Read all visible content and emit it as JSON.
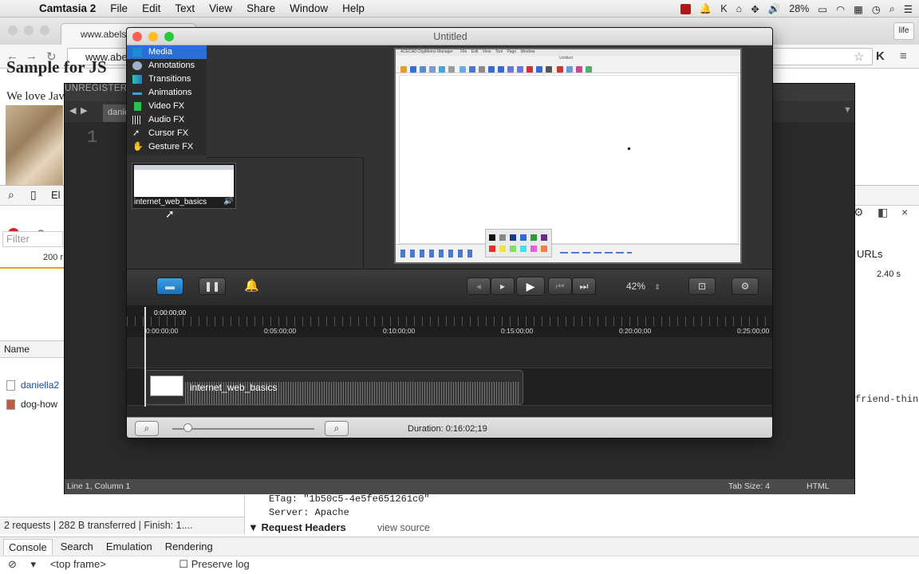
{
  "menubar": {
    "app": "Camtasia 2",
    "items": [
      "File",
      "Edit",
      "Text",
      "View",
      "Share",
      "Window",
      "Help"
    ],
    "battery": "28%"
  },
  "chrome": {
    "tab_title": "www.abelski...",
    "url": "www.abe",
    "life_button": "life",
    "page_title": "Sample for JS",
    "page_text": "We love Jav"
  },
  "devtools": {
    "filter_placeholder": "Filter",
    "timeline_tick": "200 r",
    "name_header": "Name",
    "rows": [
      "daniella2",
      "dog-how"
    ],
    "right_header": "URLs",
    "right_time": "2.40 s",
    "right_code": "friend-thin",
    "etag_line": "ETag: \"1b50c5-4e5fe651261c0\"",
    "server_line": "Server: Apache",
    "request_headers": "Request Headers",
    "view_source": "view source",
    "status": "2 requests | 282 B transferred | Finish: 1....",
    "tabs": [
      "Console",
      "Search",
      "Emulation",
      "Rendering"
    ],
    "console_scope": "<top frame>",
    "preserve_log": "Preserve log"
  },
  "editor": {
    "unregistered": "UNREGISTERED",
    "tab": "danie",
    "line_number": "1",
    "status_position": "Line 1, Column 1",
    "status_tabsize": "Tab Size: 4",
    "status_lang": "HTML"
  },
  "camtasia": {
    "window_title": "Untitled",
    "sidebar": [
      "Media",
      "Annotations",
      "Transitions",
      "Animations",
      "Video FX",
      "Audio FX",
      "Cursor FX",
      "Gesture FX"
    ],
    "clip_name": "internet_web_basics",
    "preview_app_title": "ACECAD DigiMemo Manager",
    "preview_menu": [
      "File",
      "Edit",
      "View",
      "Tool",
      "Page",
      "Window"
    ],
    "preview_doc_title": "Untitled",
    "zoom": "42%",
    "playhead_time": "0:00:00;00",
    "ruler_labels": [
      "0:00:00;00",
      "0:05:00;00",
      "0:10:00;00",
      "0:15:00;00",
      "0:20:00;00",
      "0:25:00;00"
    ],
    "duration": "Duration: 0:16:02;19",
    "colors": {
      "selected": "#2a6fd6",
      "close": "#fc5f57",
      "min": "#fdbc2e",
      "max": "#28c840"
    }
  }
}
